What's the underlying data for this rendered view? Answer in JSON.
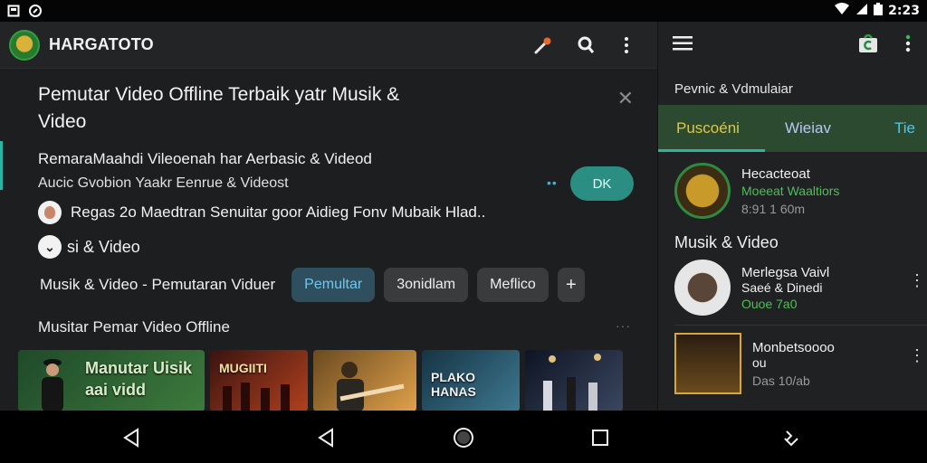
{
  "status_bar": {
    "time": "2:23",
    "left_icons": [
      "square-notification-icon",
      "circle-clock-icon"
    ],
    "right_icons": [
      "wifi-icon",
      "signal-icon",
      "battery-icon"
    ]
  },
  "app_bar": {
    "title": "HARGATOTO",
    "actions": [
      "mic-icon",
      "cast-icon",
      "more-vert-icon"
    ]
  },
  "banner": {
    "title": "Pemutar Video Offline Terbaik yatr Musik & Video",
    "subtitle_1": "RemaraMaahdi Vileoenah har Aerbasic & Videod",
    "subtitle_2": "Aucic Gvobion Yaakr Eenrue & Videost",
    "user_row": "Regas 2o Maedtran Senuitar goor Aidieg Fonv Mubaik Hlad..",
    "action_label": "si & Video",
    "ok_button": "DK",
    "dots": "••"
  },
  "chips": {
    "plain": "Musik & Video -  Pemutaran Viduer",
    "items": [
      "Pemultar",
      "3onidlam",
      "Meflico"
    ],
    "active_index": 0,
    "add_label": "+"
  },
  "section": {
    "title": "Musitar Pemar Video Offline",
    "more": "···"
  },
  "thumbnails": [
    {
      "label_1": "Manutar Uisik",
      "label_2": "aai vidd",
      "colors": [
        "#1f4a2a",
        "#3d7a3c"
      ]
    },
    {
      "label_1": "MUGIITI",
      "label_2": "",
      "colors": [
        "#3a1410",
        "#b0401e"
      ]
    },
    {
      "label_1": "",
      "label_2": "",
      "colors": [
        "#6a4a20",
        "#e0a14a"
      ]
    },
    {
      "label_1": "PLAKO HANAS",
      "label_2": "",
      "colors": [
        "#163444",
        "#3e7890"
      ]
    },
    {
      "label_1": "",
      "label_2": "",
      "colors": [
        "#0e1422",
        "#3a4660"
      ]
    }
  ],
  "side_panel": {
    "header": "Pevnic & Vdmulaiar",
    "tabs": [
      "Puscoéni",
      "Wieiav",
      "Tie"
    ],
    "active_tab": 0,
    "featured": {
      "line_1": "Hecacteoat",
      "line_2": "Moeeat Waaltiors",
      "line_3": "8:91 1 60m"
    },
    "section_title": "Musik & Video",
    "list": [
      {
        "line_1": "Merlegsa Vaivl",
        "line_2": "Saeé & Dinedi",
        "line_3": "Ouoe 7a0"
      },
      {
        "line_1": "Monbetsoooo",
        "line_2": "ou",
        "line_3": "Das 10/ab"
      }
    ]
  },
  "nav_bar": {
    "buttons": [
      "back-icon",
      "back-icon",
      "home-icon",
      "recents-icon",
      "assist-icon"
    ]
  }
}
